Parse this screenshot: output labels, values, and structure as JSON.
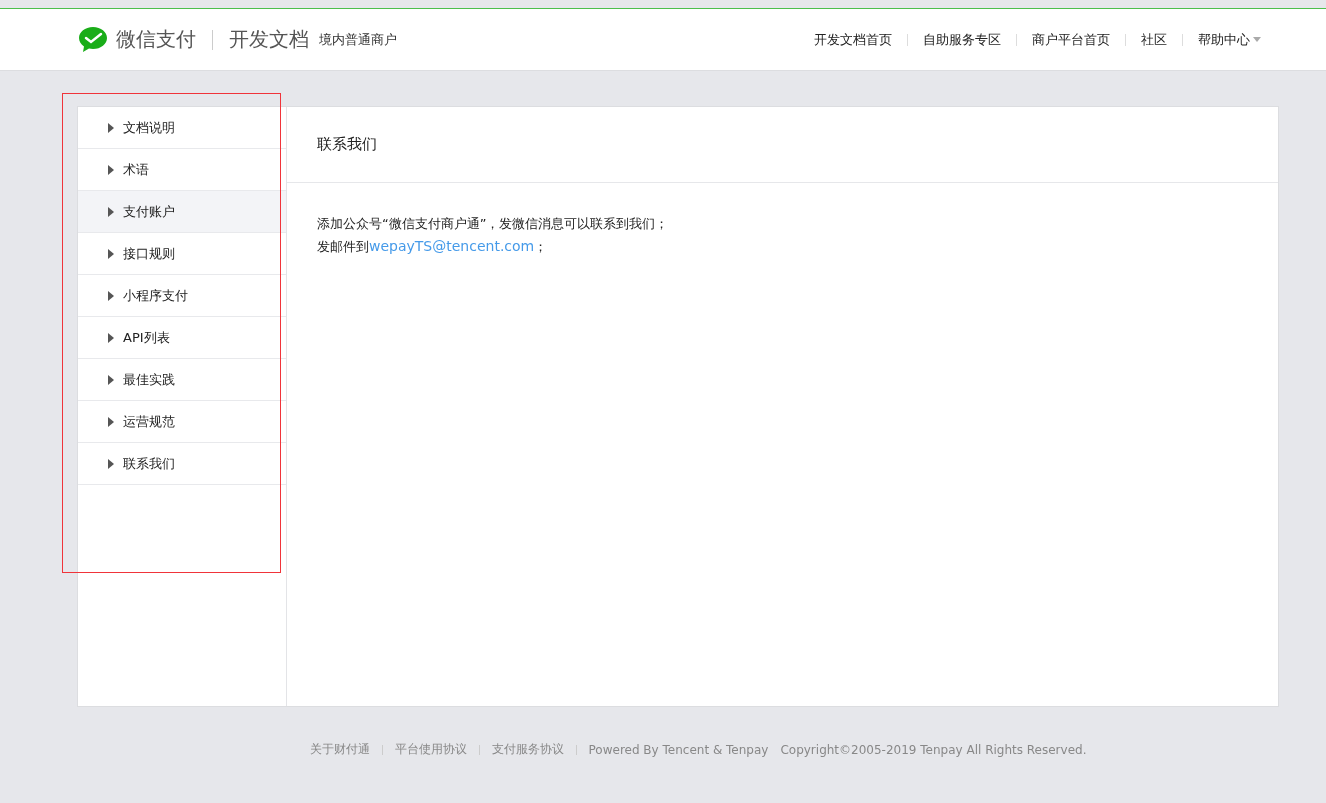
{
  "header": {
    "brand": "微信支付",
    "product": "开发文档",
    "subtitle": "境内普通商户",
    "nav": [
      {
        "label": "开发文档首页",
        "dropdown": false
      },
      {
        "label": "自助服务专区",
        "dropdown": false
      },
      {
        "label": "商户平台首页",
        "dropdown": false
      },
      {
        "label": "社区",
        "dropdown": false
      },
      {
        "label": "帮助中心",
        "dropdown": true
      }
    ]
  },
  "sidebar": {
    "items": [
      {
        "label": "文档说明",
        "selected": false
      },
      {
        "label": "术语",
        "selected": false
      },
      {
        "label": "支付账户",
        "selected": true
      },
      {
        "label": "接口规则",
        "selected": false
      },
      {
        "label": "小程序支付",
        "selected": false
      },
      {
        "label": "API列表",
        "selected": false
      },
      {
        "label": "最佳实践",
        "selected": false
      },
      {
        "label": "运营规范",
        "selected": false
      },
      {
        "label": "联系我们",
        "selected": false
      }
    ]
  },
  "content": {
    "title": "联系我们",
    "lines": [
      {
        "text": "添加公众号“微信支付商户通”，发微信消息可以联系到我们；"
      },
      {
        "text": "发邮件到",
        "link": "wepayTS@tencent.com",
        "suffix": "；"
      }
    ]
  },
  "footer": {
    "links": [
      "关于财付通",
      "平台使用协议",
      "支付服务协议",
      "Powered By Tencent & Tenpay"
    ],
    "copyright": "Copyright©2005-2019 Tenpay All Rights Reserved."
  }
}
